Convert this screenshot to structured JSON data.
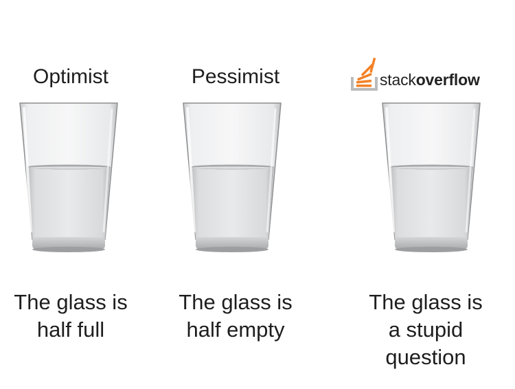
{
  "panels": [
    {
      "heading": "Optimist",
      "caption_lines": [
        "The glass is",
        "half full"
      ]
    },
    {
      "heading": "Pessimist",
      "caption_lines": [
        "The glass is",
        "half empty"
      ]
    },
    {
      "logo": {
        "word_light": "stack",
        "word_bold": "overflow",
        "accent_color": "#f48024",
        "tray_color": "#bcbbbb"
      },
      "caption_lines": [
        "The glass is",
        "a stupid",
        "question"
      ]
    }
  ],
  "water_level": 0.5
}
